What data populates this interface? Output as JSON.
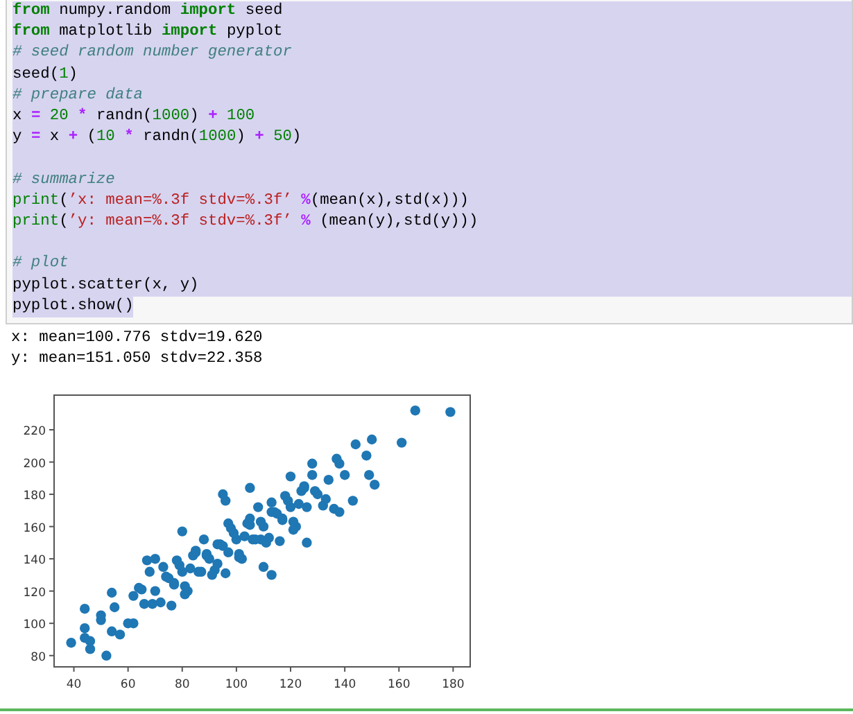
{
  "code": {
    "lines": [
      {
        "selected": true,
        "tokens": [
          {
            "kind": "keyword",
            "text": "from"
          },
          {
            "kind": "plain",
            "text": " numpy.random "
          },
          {
            "kind": "keyword",
            "text": "import"
          },
          {
            "kind": "plain",
            "text": " seed"
          }
        ]
      },
      {
        "selected": true,
        "tokens": [
          {
            "kind": "keyword",
            "text": "from"
          },
          {
            "kind": "plain",
            "text": " matplotlib "
          },
          {
            "kind": "keyword",
            "text": "import"
          },
          {
            "kind": "plain",
            "text": " pyplot"
          }
        ]
      },
      {
        "selected": true,
        "tokens": [
          {
            "kind": "comment",
            "text": "# seed random number generator"
          }
        ]
      },
      {
        "selected": true,
        "tokens": [
          {
            "kind": "plain",
            "text": "seed("
          },
          {
            "kind": "number",
            "text": "1"
          },
          {
            "kind": "plain",
            "text": ")"
          }
        ]
      },
      {
        "selected": true,
        "tokens": [
          {
            "kind": "comment",
            "text": "# prepare data"
          }
        ]
      },
      {
        "selected": true,
        "tokens": [
          {
            "kind": "plain",
            "text": "x "
          },
          {
            "kind": "operator",
            "text": "= "
          },
          {
            "kind": "number",
            "text": "20"
          },
          {
            "kind": "operator",
            "text": " * "
          },
          {
            "kind": "plain",
            "text": "randn("
          },
          {
            "kind": "number",
            "text": "1000"
          },
          {
            "kind": "plain",
            "text": ") "
          },
          {
            "kind": "operator",
            "text": "+ "
          },
          {
            "kind": "number",
            "text": "100"
          }
        ]
      },
      {
        "selected": true,
        "tokens": [
          {
            "kind": "plain",
            "text": "y "
          },
          {
            "kind": "operator",
            "text": "="
          },
          {
            "kind": "plain",
            "text": " x "
          },
          {
            "kind": "operator",
            "text": "+"
          },
          {
            "kind": "plain",
            "text": " ("
          },
          {
            "kind": "number",
            "text": "10"
          },
          {
            "kind": "operator",
            "text": " * "
          },
          {
            "kind": "plain",
            "text": "randn("
          },
          {
            "kind": "number",
            "text": "1000"
          },
          {
            "kind": "plain",
            "text": ") "
          },
          {
            "kind": "operator",
            "text": "+ "
          },
          {
            "kind": "number",
            "text": "50"
          },
          {
            "kind": "plain",
            "text": ")"
          }
        ]
      },
      {
        "selected": true
      },
      {
        "selected": true,
        "tokens": [
          {
            "kind": "comment",
            "text": "# summarize"
          }
        ]
      },
      {
        "selected": true,
        "tokens": [
          {
            "kind": "builtin",
            "text": "print"
          },
          {
            "kind": "plain",
            "text": "("
          },
          {
            "kind": "string",
            "text": "’x: mean=%.3f stdv=%.3f’"
          },
          {
            "kind": "operator",
            "text": " %"
          },
          {
            "kind": "plain",
            "text": "(mean(x),std(x)))"
          }
        ]
      },
      {
        "selected": true,
        "tokens": [
          {
            "kind": "builtin",
            "text": "print"
          },
          {
            "kind": "plain",
            "text": "("
          },
          {
            "kind": "string",
            "text": "’y: mean=%.3f stdv=%.3f’"
          },
          {
            "kind": "operator",
            "text": " %"
          },
          {
            "kind": "plain",
            "text": " (mean(y),std(y)))"
          }
        ]
      },
      {
        "selected": true
      },
      {
        "selected": true,
        "tokens": [
          {
            "kind": "comment",
            "text": "# plot"
          }
        ]
      },
      {
        "selected": true,
        "tokens": [
          {
            "kind": "plain",
            "text": "pyplot.scatter(x, y)"
          }
        ]
      },
      {
        "selected": true,
        "tokens": [
          {
            "kind": "plain",
            "text": "pyplot.show()"
          }
        ]
      }
    ]
  },
  "output": {
    "lines": [
      "x: mean=100.776 stdv=19.620",
      "y: mean=151.050 stdv=22.358"
    ],
    "chart_data": {
      "type": "scatter",
      "xlim": [
        32.7,
        186.3
      ],
      "ylim": [
        73,
        241.5
      ],
      "xticks": [
        40,
        60,
        80,
        100,
        120,
        140,
        160,
        180
      ],
      "yticks": [
        80,
        100,
        120,
        140,
        160,
        180,
        200,
        220
      ],
      "x": [
        62,
        64,
        66,
        68,
        70,
        72,
        74,
        76,
        78,
        80,
        82,
        84,
        86,
        88,
        90,
        92,
        94,
        96,
        98,
        100,
        102,
        104,
        106,
        108,
        110,
        112,
        114,
        116,
        118,
        120,
        122,
        124,
        126,
        128,
        130,
        132,
        134,
        136,
        138,
        140,
        65,
        69,
        73,
        77,
        81,
        85,
        89,
        93,
        97,
        101,
        105,
        109,
        113,
        117,
        121,
        125,
        129,
        133,
        137,
        75,
        77,
        79,
        81,
        83,
        85,
        87,
        89,
        91,
        93,
        95,
        97,
        99,
        101,
        103,
        105,
        107,
        109,
        111,
        113,
        115,
        117,
        119,
        121,
        123,
        125,
        39,
        44,
        44,
        44,
        46,
        46,
        52,
        50,
        50,
        54,
        54,
        57,
        55,
        60,
        62,
        67,
        70,
        80,
        95,
        96,
        105,
        113,
        110,
        126,
        138,
        143,
        144,
        150,
        151,
        149,
        148,
        161,
        166,
        179,
        128,
        120
      ],
      "series": [
        {
          "color": "#1f77b4",
          "values": [
            100,
            122,
            112,
            132,
            120,
            113,
            129,
            111,
            139,
            132,
            120,
            142,
            132,
            152,
            140,
            133,
            149,
            131,
            159,
            152,
            140,
            162,
            152,
            172,
            160,
            153,
            169,
            151,
            179,
            172,
            160,
            182,
            172,
            192,
            180,
            173,
            189,
            171,
            199,
            192,
            121,
            112,
            135,
            125,
            118,
            144,
            142,
            137,
            162,
            141,
            161,
            152,
            175,
            165,
            158,
            184,
            182,
            177,
            202,
            128,
            124,
            136,
            123,
            134,
            145,
            132,
            143,
            130,
            149,
            148,
            144,
            156,
            143,
            154,
            165,
            152,
            163,
            150,
            169,
            168,
            164,
            176,
            163,
            174,
            185,
            88,
            109,
            97,
            91,
            84,
            89,
            80,
            105,
            102,
            119,
            95,
            93,
            110,
            100,
            117,
            139,
            140,
            157,
            180,
            176,
            184,
            130,
            135,
            150,
            169,
            176,
            211,
            214,
            186,
            192,
            204,
            212,
            232,
            231,
            199,
            191
          ]
        }
      ]
    }
  }
}
